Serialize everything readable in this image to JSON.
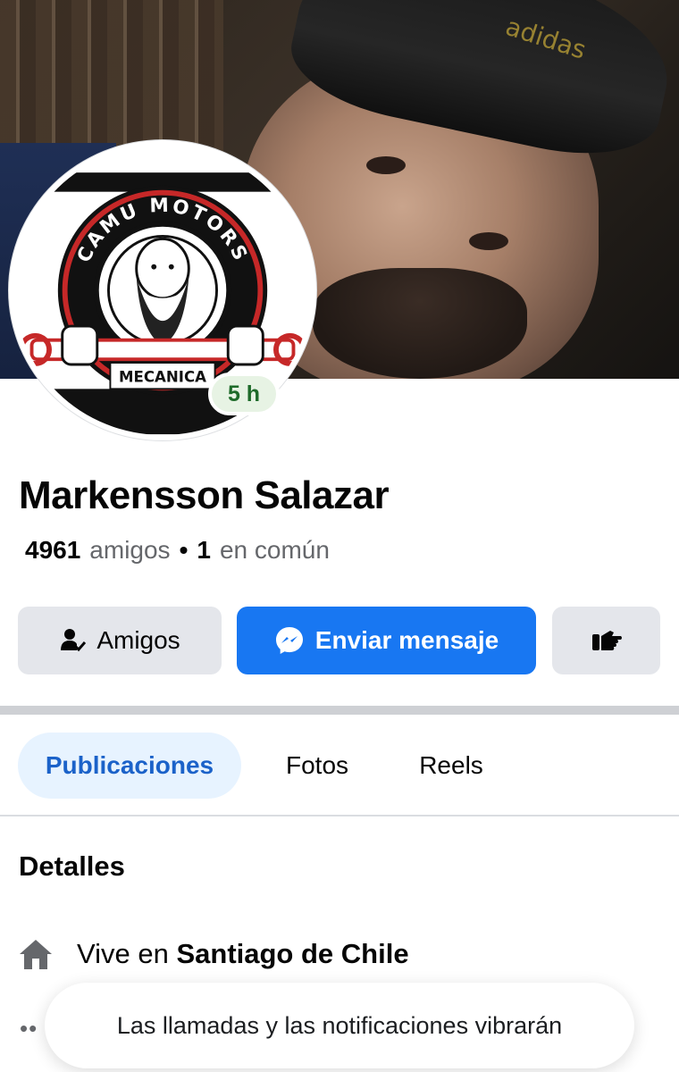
{
  "profile": {
    "name": "Markensson Salazar",
    "friends_count": "4961",
    "friends_label": "amigos",
    "mutual_count": "1",
    "mutual_label": "en común",
    "avatar_time_badge": "5 h",
    "avatar_logo": {
      "top_text": "CAMU MOTORS",
      "bottom_text": "MECANICA"
    },
    "cover_cap_text": "adidas"
  },
  "actions": {
    "friends_label": "Amigos",
    "message_label": "Enviar mensaje",
    "more_icon": "hand-pointing-icon"
  },
  "tabs": [
    {
      "label": "Publicaciones",
      "active": true
    },
    {
      "label": "Fotos",
      "active": false
    },
    {
      "label": "Reels",
      "active": false
    }
  ],
  "details": {
    "title": "Detalles",
    "lives_prefix": "Vive en",
    "lives_city": "Santiago de Chile",
    "more_glyph": "••"
  },
  "toast": {
    "text": "Las llamadas y las notificaciones vibrarán"
  },
  "colors": {
    "primary": "#1877f2",
    "active_tab_bg": "#e7f3ff",
    "active_tab_text": "#1b62c9",
    "button_gray": "#e4e6eb",
    "badge_green": "#1e6b2a"
  }
}
